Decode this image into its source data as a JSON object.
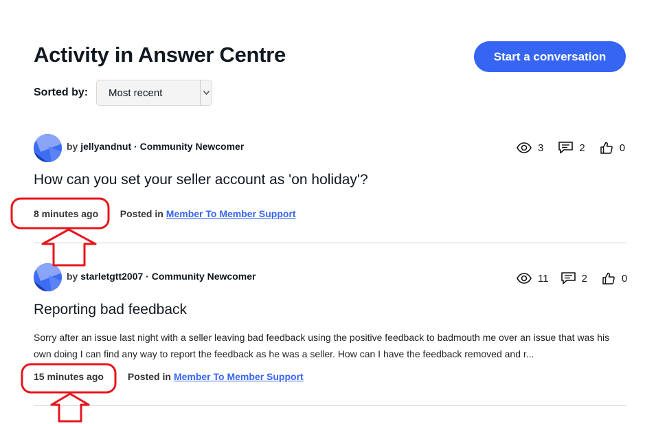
{
  "header": {
    "title": "Activity in Answer Centre",
    "start_button": "Start a conversation"
  },
  "sort": {
    "label": "Sorted by:",
    "selected": "Most recent"
  },
  "posts": [
    {
      "author_prefix": "by",
      "author": "jellyandnut",
      "rank": "Community Newcomer",
      "views": "3",
      "replies": "2",
      "kudos": "0",
      "title": "How can you set your seller account as 'on holiday'?",
      "body": "",
      "time": "8 minutes ago",
      "separator": "|",
      "posted_in_label": "Posted in",
      "board": "Member To Member Support"
    },
    {
      "author_prefix": "by",
      "author": "starletgtt2007",
      "rank": "Community Newcomer",
      "views": "11",
      "replies": "2",
      "kudos": "0",
      "title": "Reporting bad feedback",
      "body": "Sorry after an issue last night with a seller leaving bad feedback using the positive feedback to badmouth me over an issue that was his own doing I can find any way to report the feedback as he was a seller. How can I have the feedback removed and r...",
      "time": "15 minutes ago",
      "posted_in_label": "Posted in",
      "board": "Member To Member Support"
    }
  ],
  "colors": {
    "accent": "#3665f3",
    "annotation": "#e8141c",
    "divider": "#d0d0d0"
  },
  "icons": [
    "eye-icon",
    "comment-icon",
    "thumbs-up-icon",
    "chevron-down-icon",
    "avatar"
  ]
}
